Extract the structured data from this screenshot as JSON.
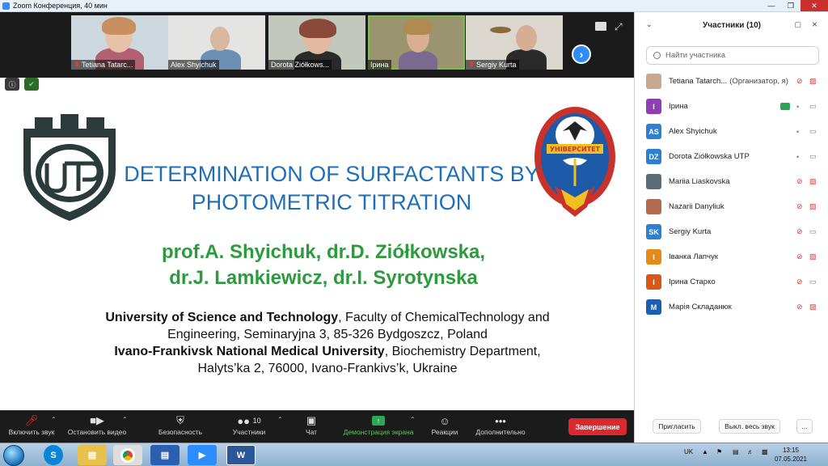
{
  "window": {
    "title": "Zoom Конференция, 40 мин"
  },
  "participants_strip": [
    {
      "name": "Tetiana Tatarc...",
      "muted": true
    },
    {
      "name": "Alex Shyichuk",
      "muted": false
    },
    {
      "name": "Dorota Ziółkows...",
      "muted": false
    },
    {
      "name": "Ірина",
      "muted": false
    },
    {
      "name": "Sergiy Kurta",
      "muted": true
    }
  ],
  "slide": {
    "title_line1": "DETERMINATION OF SURFACTANTS BY",
    "title_line2": "PHOTOMETRIC TITRATION",
    "authors_line1": "prof.A. Shyichuk, dr.D. Ziółkowska,",
    "authors_line2": "dr.J. Lamkiewicz, dr.I. Syrotynska",
    "affil1_bold": "University of Science and Technology",
    "affil1_rest": ", Faculty of ChemicalTechnology and",
    "affil2": "Engineering, Seminaryjna 3, 85-326 Bydgoszcz, Poland",
    "affil3_bold": "Ivano-Frankivsk National Medical University",
    "affil3_rest": ", Biochemistry Department,",
    "affil4": "Halyts’ka 2, 76000, Ivano-Frankivs’k, Ukraine",
    "left_logo_text": "UTP",
    "right_logo_text": "УНІВЕРСИТЕТ"
  },
  "toolbar": {
    "unmute": "Включить звук",
    "stop_video": "Остановить видео",
    "security": "Безопасность",
    "participants": "Участники",
    "participants_count": "10",
    "chat": "Чат",
    "share_screen": "Демонстрация экрана",
    "reactions": "Реакции",
    "more": "Дополнительно",
    "end": "Завершение"
  },
  "panel": {
    "title": "Участники (10)",
    "search_placeholder": "Найти участника",
    "participants": [
      {
        "name": "Tetiana Tatarch...",
        "role": "(Организатор, я)",
        "initials": "",
        "color": "#c8a890",
        "mic": "muted",
        "video": "off"
      },
      {
        "name": "Ірина",
        "role": "",
        "initials": "I",
        "color": "#8e3fb3",
        "mic": "on",
        "video": "on",
        "sharing": true
      },
      {
        "name": "Alex Shyichuk",
        "role": "",
        "initials": "AS",
        "color": "#2d7fd3",
        "mic": "on",
        "video": "on"
      },
      {
        "name": "Dorota Ziółkowska UTP",
        "role": "",
        "initials": "DZ",
        "color": "#2d7fd3",
        "mic": "on",
        "video": "on"
      },
      {
        "name": "Mariia Liaskovska",
        "role": "",
        "initials": "",
        "color": "#5a6b7a",
        "mic": "muted",
        "video": "off"
      },
      {
        "name": "Nazarii Danyliuk",
        "role": "",
        "initials": "",
        "color": "#b36a50",
        "mic": "muted",
        "video": "off"
      },
      {
        "name": "Sergiy Kurta",
        "role": "",
        "initials": "SK",
        "color": "#2d7fd3",
        "mic": "muted",
        "video": "on"
      },
      {
        "name": "Іванка Лапчук",
        "role": "",
        "initials": "I",
        "color": "#e88a1a",
        "mic": "muted",
        "video": "off"
      },
      {
        "name": "Ірина Старко",
        "role": "",
        "initials": "I",
        "color": "#d8581a",
        "mic": "muted",
        "video": "on"
      },
      {
        "name": "Марія Складанюк",
        "role": "",
        "initials": "M",
        "color": "#1a5fb4",
        "mic": "muted",
        "video": "off"
      }
    ],
    "invite": "Пригласить",
    "mute_all": "Выкл. весь звук",
    "more": "..."
  },
  "taskbar": {
    "lang": "UK",
    "time": "13:15",
    "date": "07.05.2021"
  }
}
